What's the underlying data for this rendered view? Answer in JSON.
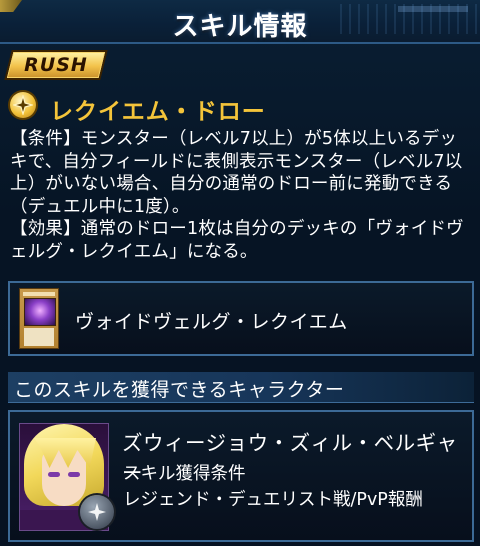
{
  "header": {
    "title": "スキル情報"
  },
  "badge": {
    "label": "RUSH"
  },
  "skill": {
    "name": "レクイエム・ドロー",
    "icon": "star-burst-icon",
    "accent_color": "#f4c43a",
    "description": [
      "【条件】モンスター（レベル7以上）が5体以上いるデッ",
      "キで、自分フィールドに表側表示モンスター（レベル7以",
      "上）がいない場合、自分の通常のドロー前に発動できる",
      "（デュエル中に1度）。",
      "【効果】通常のドロー1枚は自分のデッキの「ヴォイドヴ",
      "ェルグ・レクイエム」になる。"
    ]
  },
  "card": {
    "name": "ヴォイドヴェルグ・レクイエム"
  },
  "section": {
    "acquire_title": "このスキルを獲得できるキャラクター"
  },
  "character": {
    "name": "ズウィージョウ・ズィル・ベルギャー",
    "condition_label": "スキル獲得条件",
    "condition_value": "レジェンド・デュエリスト戦/PvP報酬"
  }
}
